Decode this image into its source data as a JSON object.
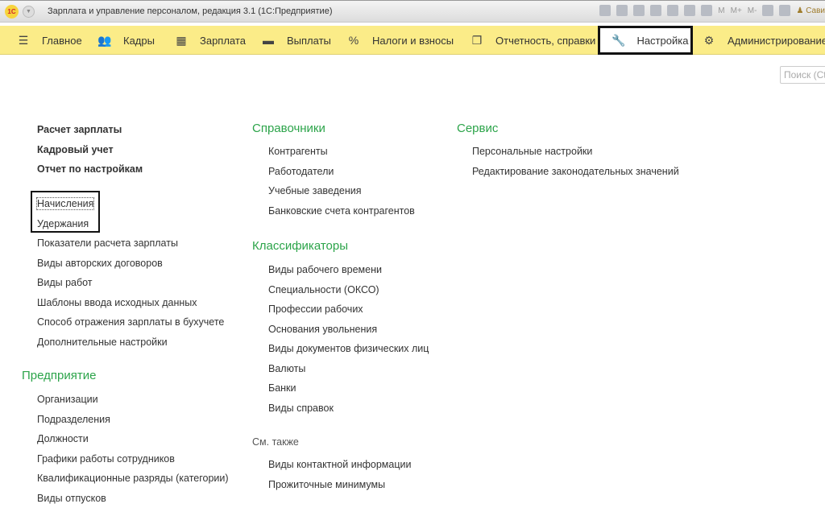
{
  "window": {
    "title": "Зарплата и управление персоналом, редакция 3.1  (1С:Предприятие)",
    "logo": "1С",
    "user": "Сави",
    "memory_buttons": [
      "M",
      "M+",
      "M-"
    ]
  },
  "nav": [
    {
      "label": "Главное",
      "icon": "menu-icon"
    },
    {
      "label": "Кадры",
      "icon": "users-icon"
    },
    {
      "label": "Зарплата",
      "icon": "calculator-icon"
    },
    {
      "label": "Выплаты",
      "icon": "card-icon"
    },
    {
      "label": "Налоги и взносы",
      "icon": "percent-icon"
    },
    {
      "label": "Отчетность, справки",
      "icon": "reports-icon"
    },
    {
      "label": "Настройка",
      "icon": "wrench-icon",
      "active": true
    },
    {
      "label": "Администрирование",
      "icon": "gear-icon"
    }
  ],
  "search": {
    "placeholder": "Поиск (Ct"
  },
  "left": {
    "bold_items": [
      "Расчет зарплаты",
      "Кадровый учет",
      "Отчет по настройкам"
    ],
    "items": [
      "Начисления",
      "Удержания",
      "Показатели расчета зарплаты",
      "Виды авторских договоров",
      "Виды работ",
      "Шаблоны ввода исходных данных",
      "Способ отражения зарплаты в бухучете",
      "Дополнительные настройки"
    ],
    "enterprise": {
      "title": "Предприятие",
      "items": [
        "Организации",
        "Подразделения",
        "Должности",
        "Графики работы сотрудников",
        "Квалификационные разряды (категории)",
        "Виды отпусков"
      ]
    }
  },
  "middle": {
    "directories": {
      "title": "Справочники",
      "items": [
        "Контрагенты",
        "Работодатели",
        "Учебные заведения",
        "Банковские счета контрагентов"
      ]
    },
    "classifiers": {
      "title": "Классификаторы",
      "items": [
        "Виды рабочего времени",
        "Специальности (ОКСО)",
        "Профессии рабочих",
        "Основания увольнения",
        "Виды документов физических лиц",
        "Валюты",
        "Банки",
        "Виды справок"
      ]
    },
    "see_also": {
      "title": "См. также",
      "items": [
        "Виды контактной информации",
        "Прожиточные минимумы"
      ]
    }
  },
  "right": {
    "service": {
      "title": "Сервис",
      "items": [
        "Персональные настройки",
        "Редактирование законодательных значений"
      ]
    }
  },
  "colors": {
    "section_header": "#2ca44a",
    "navbar": "#fbec88"
  }
}
